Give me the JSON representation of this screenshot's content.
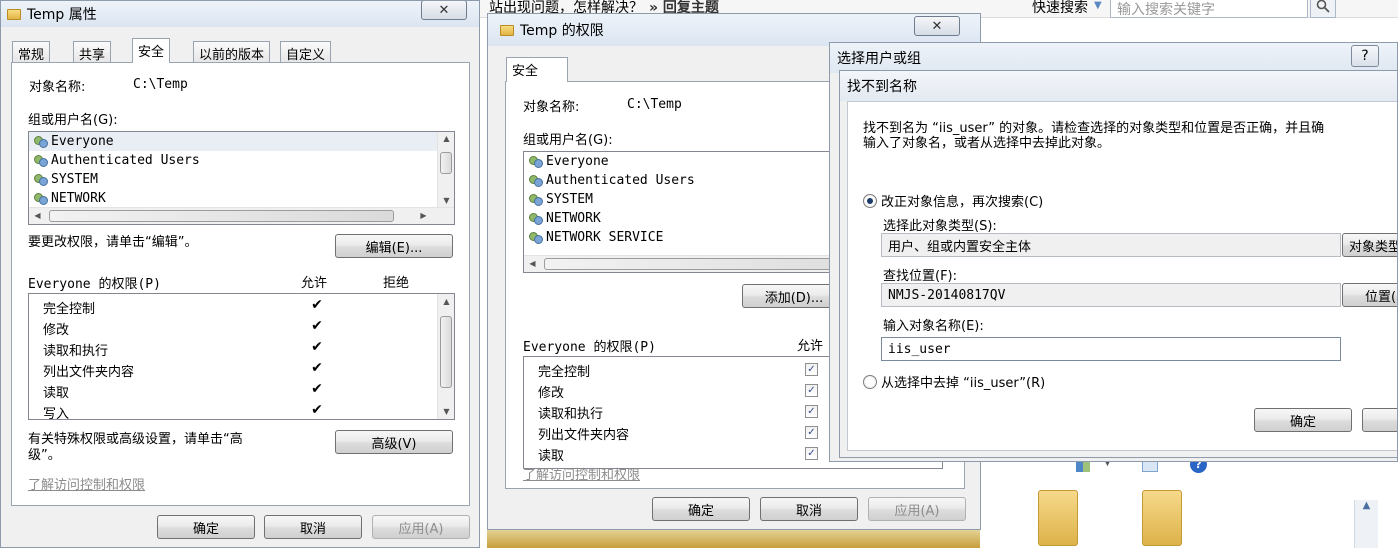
{
  "background": {
    "question_text": "站出现问题，怎样解决？",
    "reply_link": "» 回复主题",
    "quick_search": "快速搜索",
    "search_placeholder": "输入搜索关键字"
  },
  "win1": {
    "title": "Temp 属性",
    "tabs": [
      "常规",
      "共享",
      "安全",
      "以前的版本",
      "自定义"
    ],
    "object_label": "对象名称:",
    "object_value": "C:\\Temp",
    "group_label": "组或用户名(G):",
    "users": [
      "Everyone",
      "Authenticated Users",
      "SYSTEM",
      "NETWORK"
    ],
    "edit_hint": "要更改权限，请单击“编辑”。",
    "edit_button": "编辑(E)...",
    "perm_header": "Everyone 的权限(P)",
    "allow_header": "允许",
    "deny_header": "拒绝",
    "permissions": [
      {
        "name": "完全控制",
        "allow": "✔"
      },
      {
        "name": "修改",
        "allow": "✔"
      },
      {
        "name": "读取和执行",
        "allow": "✔"
      },
      {
        "name": "列出文件夹内容",
        "allow": "✔"
      },
      {
        "name": "读取",
        "allow": "✔"
      },
      {
        "name": "写入",
        "allow": "✔"
      }
    ],
    "special_hint_1": "有关特殊权限或高级设置，请单击“高",
    "special_hint_2": "级”。",
    "advanced_button": "高级(V)",
    "learn_link": "了解访问控制和权限",
    "ok": "确定",
    "cancel": "取消",
    "apply": "应用(A)"
  },
  "win2": {
    "title": "Temp 的权限",
    "tab": "安全",
    "object_label": "对象名称:",
    "object_value": "C:\\Temp",
    "group_label": "组或用户名(G):",
    "users": [
      "Everyone",
      "Authenticated Users",
      "SYSTEM",
      "NETWORK",
      "NETWORK SERVICE"
    ],
    "add_button": "添加(D)...",
    "perm_header": "Everyone 的权限(P)",
    "allow_header": "允许",
    "permissions": [
      {
        "name": "完全控制",
        "allow": "✓"
      },
      {
        "name": "修改",
        "allow": "✓"
      },
      {
        "name": "读取和执行",
        "allow": "✓"
      },
      {
        "name": "列出文件夹内容",
        "allow": "✓"
      },
      {
        "name": "读取",
        "allow": "✓"
      }
    ],
    "learn_link": "了解访问控制和权限",
    "ok": "确定",
    "cancel": "取消",
    "apply": "应用(A)"
  },
  "win3": {
    "title": "选择用户或组",
    "help": "?"
  },
  "win4": {
    "title": "找不到名称",
    "message_line1": "找不到名为 “iis_user” 的对象。请检查选择的对象类型和位置是否正确，并且确",
    "message_line2": "输入了对象名，或者从选择中去掉此对象。",
    "option_correct": "改正对象信息，再次搜索(C)",
    "object_type_label": "选择此对象类型(S):",
    "object_type_value": "用户、组或内置安全主体",
    "object_type_button": "对象类型",
    "location_label": "查找位置(F):",
    "location_value": "NMJS-20140817QV",
    "location_button": "位置(",
    "name_label": "输入对象名称(E):",
    "name_value": "iis_user",
    "option_remove": "从选择中去掉 “iis_user”(R)",
    "ok": "确定"
  }
}
